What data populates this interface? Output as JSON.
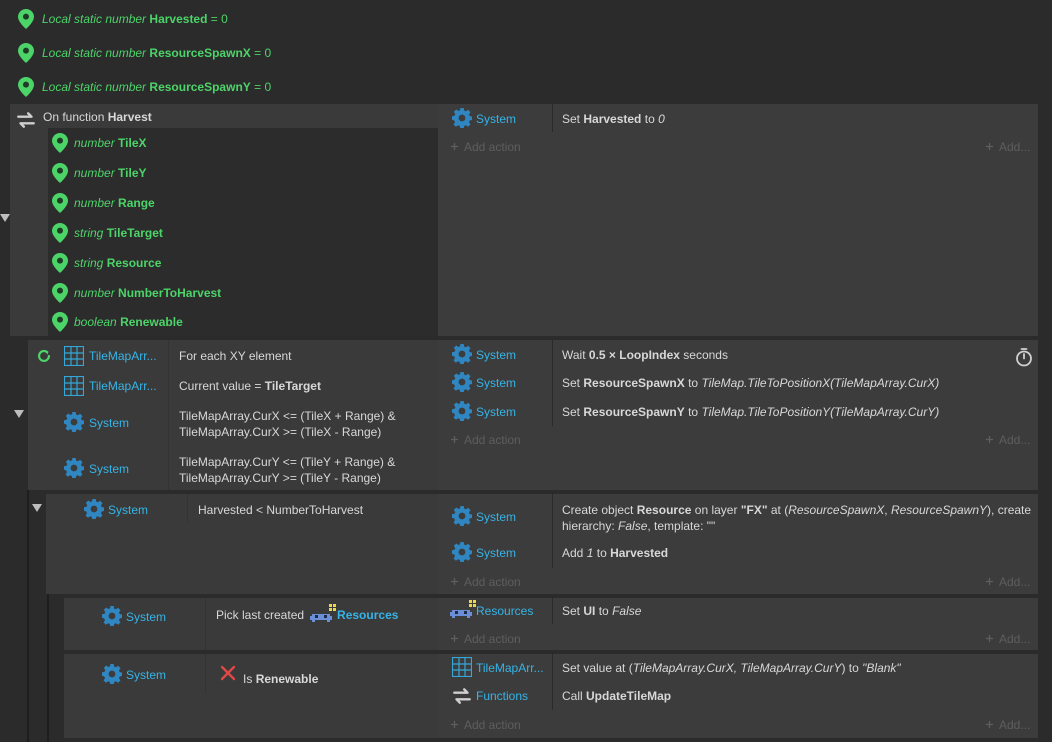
{
  "globals": [
    {
      "prefix": "Local static number",
      "name": "Harvested",
      "suffix": "= 0"
    },
    {
      "prefix": "Local static number",
      "name": "ResourceSpawnX",
      "suffix": "= 0"
    },
    {
      "prefix": "Local static number",
      "name": "ResourceSpawnY",
      "suffix": "= 0"
    }
  ],
  "function": {
    "prefix": "On function",
    "name": "Harvest",
    "params": [
      {
        "type": "number",
        "name": "TileX"
      },
      {
        "type": "number",
        "name": "TileY"
      },
      {
        "type": "number",
        "name": "Range"
      },
      {
        "type": "string",
        "name": "TileTarget"
      },
      {
        "type": "string",
        "name": "Resource"
      },
      {
        "type": "number",
        "name": "NumberToHarvest"
      },
      {
        "type": "boolean",
        "name": "Renewable"
      }
    ],
    "action": {
      "object": "System",
      "pre": "Set",
      "name": "Harvested",
      "mid": "to",
      "value": "0"
    }
  },
  "labels": {
    "add_action": "Add action",
    "add": "Add...",
    "system": "System",
    "tilemaparray": "TileMapArr...",
    "resources": "Resources",
    "functions": "Functions"
  },
  "loop": {
    "c1": "For each XY element",
    "c2_pre": "Current value =",
    "c2_name": "TileTarget",
    "c3_l1": "TileMapArray.CurX <= (TileX + Range) &",
    "c3_l2": "TileMapArray.CurX >= (TileX - Range)",
    "c4_l1": "TileMapArray.CurY <= (TileY + Range) &",
    "c4_l2": "TileMapArray.CurY >= (TileY - Range)",
    "a1_pre": "Wait",
    "a1_val": "0.5 × LoopIndex",
    "a1_suf": "seconds",
    "a2_pre": "Set",
    "a2_name": "ResourceSpawnX",
    "a2_mid": "to",
    "a2_val": "TileMap.TileToPositionX(TileMapArray.CurX)",
    "a3_pre": "Set",
    "a3_name": "ResourceSpawnY",
    "a3_mid": "to",
    "a3_val": "TileMap.TileToPositionY(TileMapArray.CurY)"
  },
  "sub1": {
    "cond": "Harvested < NumberToHarvest",
    "a1_p1": "Create object",
    "a1_obj": "Resource",
    "a1_p2": "on layer",
    "a1_layer": "\"FX\"",
    "a1_p3": "at (",
    "a1_x": "ResourceSpawnX",
    "a1_comma": ",",
    "a1_y": "ResourceSpawnY",
    "a1_p4": "), create",
    "a1_l2a": "hierarchy:",
    "a1_false": "False",
    "a1_l2b": ", template: \"\"",
    "a2_pre": "Add",
    "a2_val": "1",
    "a2_mid": "to",
    "a2_name": "Harvested"
  },
  "sub2": {
    "cond_pre": "Pick last created",
    "a1_pre": "Set",
    "a1_name": "UI",
    "a1_mid": "to",
    "a1_val": "False"
  },
  "sub3": {
    "cond_pre": "Is",
    "cond_name": "Renewable",
    "a1_pre": "Set value at (",
    "a1_val": "TileMapArray.CurX, TileMapArray.CurY",
    "a1_mid": ") to",
    "a1_str": "\"Blank\"",
    "a2_pre": "Call",
    "a2_name": "UpdateTileMap"
  },
  "colors": {
    "accent_green": "#4cd469",
    "accent_cyan": "#35b4e8",
    "remove_red": "#e04848"
  }
}
